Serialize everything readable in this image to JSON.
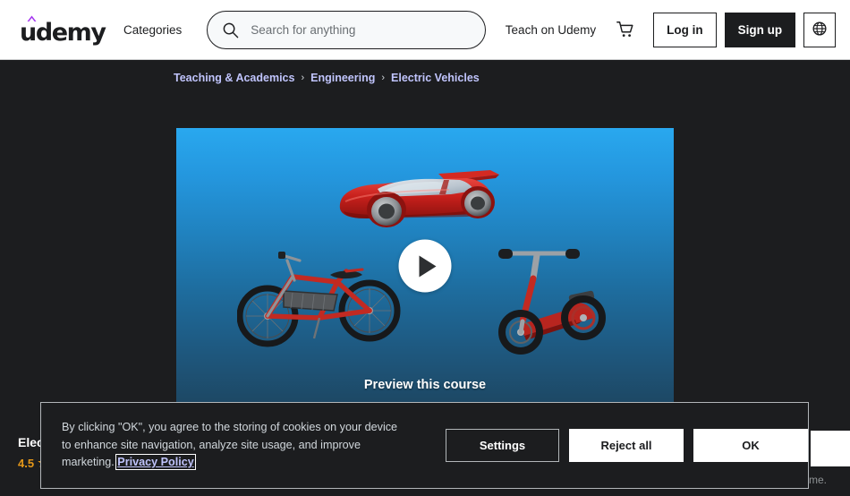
{
  "header": {
    "logo_text": "udemy",
    "logo_accent_color": "#a435f0",
    "categories_label": "Categories",
    "search_placeholder": "Search for anything",
    "search_value": "",
    "teach_label": "Teach on Udemy",
    "cart_icon": "shopping-cart-icon",
    "login_label": "Log in",
    "signup_label": "Sign up",
    "language_icon": "globe-icon"
  },
  "breadcrumb": {
    "separator": "›",
    "items": [
      {
        "label": "Teaching & Academics"
      },
      {
        "label": "Engineering"
      },
      {
        "label": "Electric Vehicles"
      }
    ],
    "link_color": "#c0c4fc"
  },
  "video_preview": {
    "caption": "Preview this course",
    "play_icon": "play-icon",
    "gradient_top": "#29a8ef",
    "gradient_bottom": "#1d4763",
    "vehicles": [
      {
        "name": "electric-car-illustration"
      },
      {
        "name": "electric-bicycle-illustration"
      },
      {
        "name": "electric-scooter-illustration"
      }
    ]
  },
  "course_aside": {
    "title_truncated": "Elec",
    "rating": "4.5",
    "star_icon": "★",
    "rating_color": "#e59819"
  },
  "partial_right": {
    "faint_text": "time."
  },
  "cookie_banner": {
    "body_before_link": "By clicking \"OK\", you agree to the storing of cookies on your device to enhance site navigation, analyze site usage, and improve marketing. ",
    "link_label": "Privacy Policy",
    "settings_label": "Settings",
    "reject_label": "Reject all",
    "ok_label": "OK",
    "border_color": "#b2b6b9",
    "background": "#1c1d1f"
  }
}
